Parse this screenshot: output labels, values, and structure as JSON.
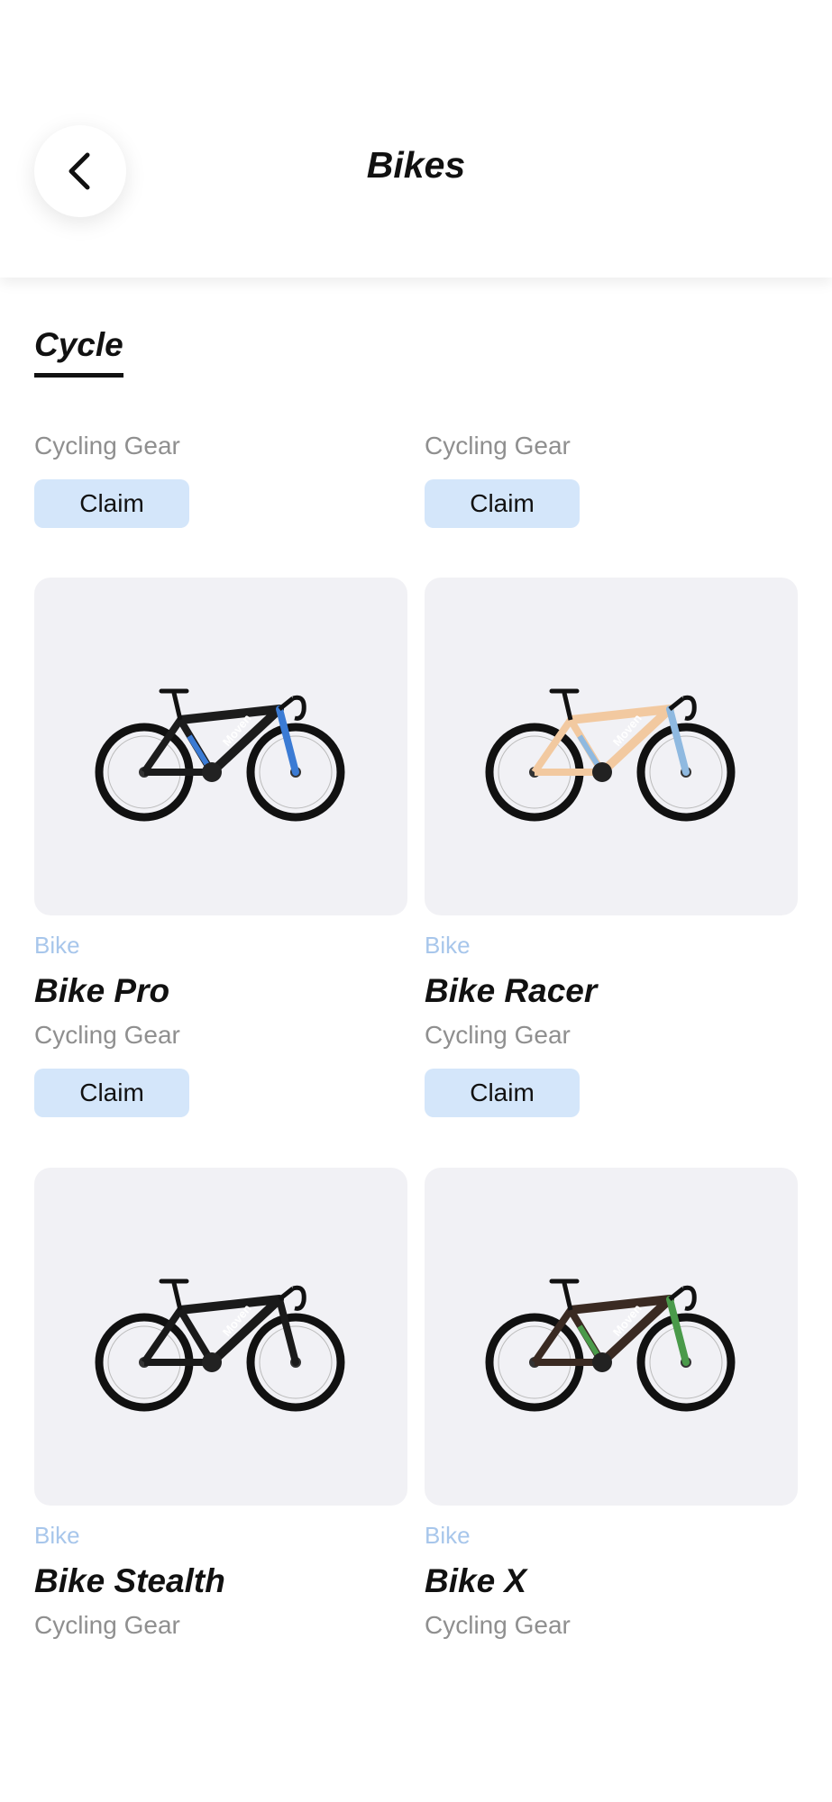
{
  "header": {
    "title": "Bikes"
  },
  "tabs": [
    {
      "label": "Cycle",
      "active": true
    }
  ],
  "top_row": [
    {
      "subtitle": "Cycling Gear",
      "claim_label": "Claim"
    },
    {
      "subtitle": "Cycling Gear",
      "claim_label": "Claim"
    }
  ],
  "products": [
    {
      "category": "Bike",
      "name": "Bike Pro",
      "subtitle": "Cycling Gear",
      "claim_label": "Claim",
      "brand": "Moven",
      "frame_color": "#1c1c1c",
      "accent_color": "#3b7bd4"
    },
    {
      "category": "Bike",
      "name": "Bike Racer",
      "subtitle": "Cycling Gear",
      "claim_label": "Claim",
      "brand": "Moven",
      "frame_color": "#f2c9a0",
      "accent_color": "#8fb9e0"
    },
    {
      "category": "Bike",
      "name": "Bike Stealth",
      "subtitle": "Cycling Gear",
      "brand": "Moven",
      "frame_color": "#1a1a1a",
      "accent_color": "#1a1a1a"
    },
    {
      "category": "Bike",
      "name": "Bike X",
      "subtitle": "Cycling Gear",
      "brand": "Moven",
      "frame_color": "#3a2a22",
      "accent_color": "#4a9a4a"
    }
  ],
  "colors": {
    "claim_bg": "#d4e6fa",
    "category_text": "#a7c6eb",
    "image_bg": "#f1f1f5"
  }
}
